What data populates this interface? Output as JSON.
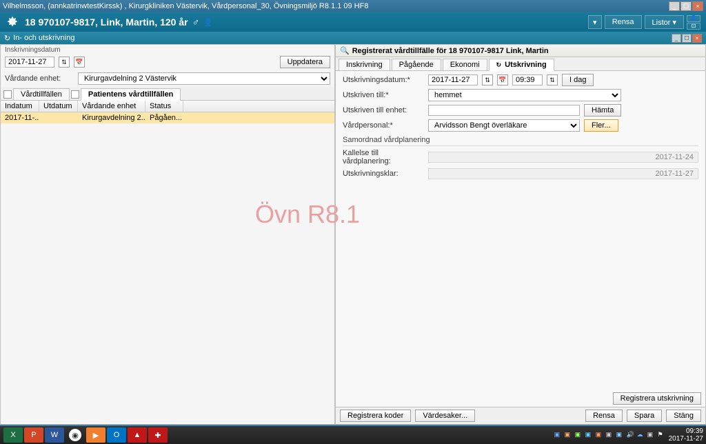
{
  "window": {
    "title": "Vilhelmsson, (annkatrinwtestKirssk) , Kirurgkliniken Västervik, Vårdpersonal_30, Övningsmiljö R8.1.1 09 HF8"
  },
  "header": {
    "patient": "18 970107-9817,  Link, Martin,  120 år",
    "rensa": "Rensa",
    "listor": "Listor ▾"
  },
  "subheader": {
    "title": "In- och utskrivning"
  },
  "left": {
    "fieldset": "Inskrivningsdatum",
    "date": "2017-11-27",
    "unit_label": "Vårdande enhet:",
    "unit_value": "Kirurgavdelning 2 Västervik",
    "uppdatera": "Uppdatera",
    "tab1": "Vårdtillfällen",
    "tab2": "Patientens vårdtillfällen",
    "cols": {
      "indatum": "Indatum",
      "utdatum": "Utdatum",
      "enhet": "Vårdande enhet",
      "status": "Status"
    },
    "row": {
      "indatum": "2017-11-...",
      "utdatum": "",
      "enhet": "Kirurgavdelning 2...",
      "status": "Pågåen..."
    }
  },
  "right": {
    "title": "Registrerat vårdtillfälle för 18 970107-9817 Link, Martin",
    "tabs": {
      "inskrivning": "Inskrivning",
      "pagaende": "Pågående",
      "ekonomi": "Ekonomi",
      "utskrivning": "Utskrivning"
    },
    "fields": {
      "utskrivningsdatum_label": "Utskrivningsdatum:*",
      "date": "2017-11-27",
      "time": "09:39",
      "idag": "I dag",
      "utskriven_till_label": "Utskriven till:*",
      "utskriven_till_value": "hemmet",
      "utskriven_enhet_label": "Utskriven till enhet:",
      "hamta": "Hämta",
      "vardpersonal_label": "Vårdpersonal:*",
      "vardpersonal_value": "Arvidsson Bengt överläkare",
      "fler": "Fler...",
      "samordnad": "Samordnad vårdplanering",
      "kallelse_label": "Kallelse till vårdplanering:",
      "kallelse_value": "2017-11-24",
      "utskrivningsklar_label": "Utskrivningsklar:",
      "utskrivningsklar_value": "2017-11-27"
    },
    "registrera_utskrivning": "Registrera utskrivning",
    "bottom": {
      "registrera_koder": "Registrera koder",
      "vardesaker": "Värdesaker...",
      "rensa": "Rensa",
      "spara": "Spara",
      "stang": "Stäng"
    }
  },
  "watermark": "Övn R8.1",
  "taskbar": {
    "time": "09:39",
    "date": "2017-11-27"
  }
}
